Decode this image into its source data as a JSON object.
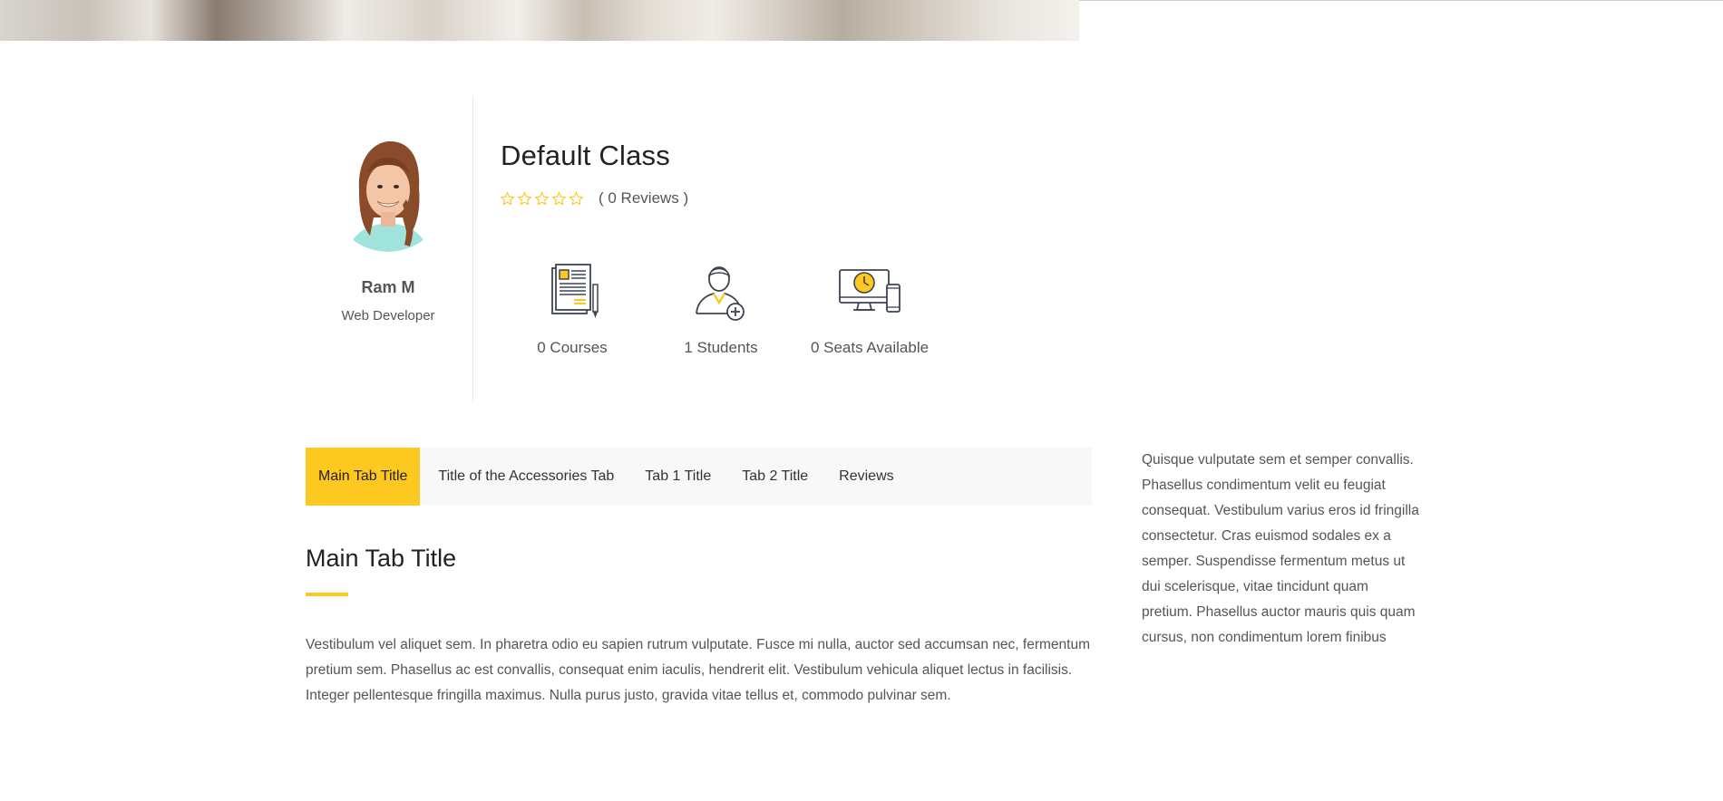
{
  "instructor": {
    "name": "Ram M",
    "role": "Web Developer"
  },
  "course": {
    "title": "Default Class",
    "rating": 0,
    "rating_max": 5,
    "reviews_label": "( 0 Reviews )"
  },
  "stats": [
    {
      "icon": "document-pencil-icon",
      "label": "0 Courses"
    },
    {
      "icon": "add-student-icon",
      "label": "1 Students"
    },
    {
      "icon": "devices-clock-icon",
      "label": "0 Seats Available"
    }
  ],
  "tabs": [
    {
      "label": "Main Tab Title",
      "active": true
    },
    {
      "label": "Title of the Accessories Tab",
      "active": false
    },
    {
      "label": "Tab 1 Title",
      "active": false
    },
    {
      "label": "Tab 2 Title",
      "active": false
    },
    {
      "label": "Reviews",
      "active": false
    }
  ],
  "main_panel": {
    "title": "Main Tab Title",
    "body": "Vestibulum vel aliquet sem. In pharetra odio eu sapien rutrum vulputate. Fusce mi nulla, auctor sed accumsan nec, fermentum pretium sem. Phasellus ac est convallis, consequat enim iaculis, hendrerit elit. Vestibulum vehicula aliquet lectus in facilisis. Integer pellentesque fringilla maximus. Nulla purus justo, gravida vitae tellus et, commodo pulvinar sem."
  },
  "sidebar": {
    "text": "Quisque vulputate sem et semper convallis. Phasellus condimentum velit eu feugiat consequat. Vestibulum varius eros id fringilla consectetur. Cras euismod sodales ex a semper. Suspendisse fermentum metus ut dui scelerisque, vitae tincidunt quam pretium. Phasellus auctor mauris quis quam cursus, non condimentum lorem finibus"
  },
  "colors": {
    "accent": "#fdc820",
    "icon_stroke": "#3d4451"
  }
}
